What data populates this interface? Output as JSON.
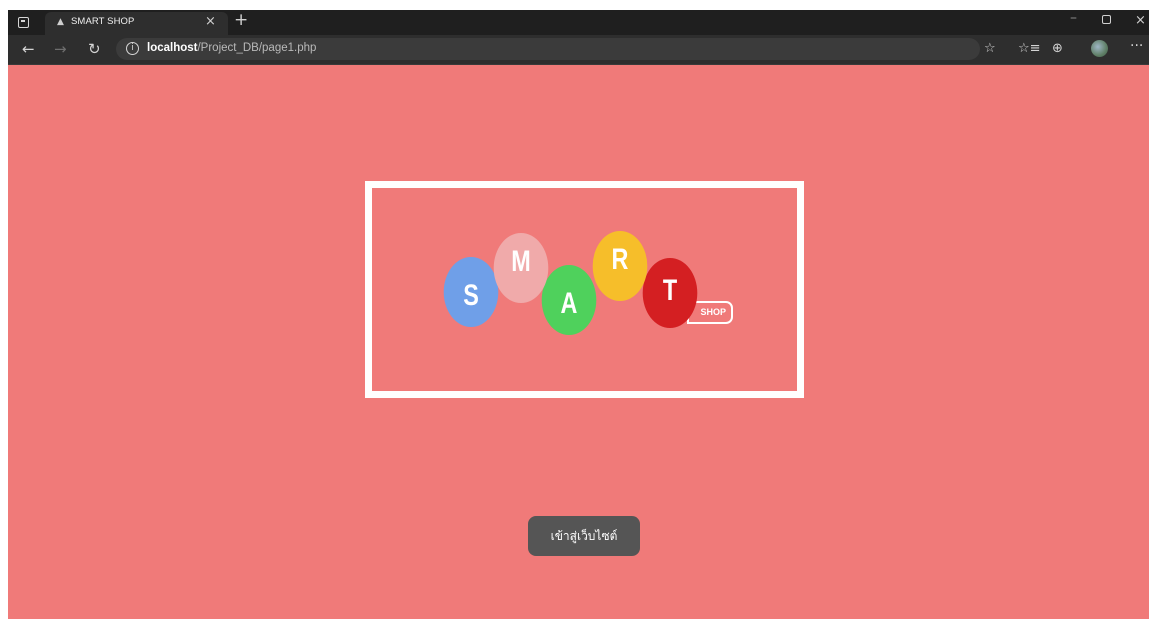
{
  "browser": {
    "tab": {
      "title": "SMART SHOP",
      "favicon_icon": "caret-up-icon",
      "close_glyph": "×"
    },
    "new_tab_glyph": "+",
    "window_controls": {
      "minimize": "–",
      "close": "×"
    },
    "nav": {
      "back": "←",
      "forward": "→",
      "refresh": "↻"
    },
    "address": {
      "info_glyph": "i",
      "host": "localhost",
      "path": "/Project_DB/page1.php"
    },
    "toolbar": {
      "favorite_glyph": "☆",
      "favorites_glyph": "☆≡",
      "collections_glyph": "⊕",
      "more_glyph": "···"
    }
  },
  "page": {
    "background": "#f07a79",
    "logo": {
      "letters": [
        {
          "char": "S",
          "color": "#6f9fe8"
        },
        {
          "char": "M",
          "color": "#f0aaaa"
        },
        {
          "char": "A",
          "color": "#4fd15c"
        },
        {
          "char": "R",
          "color": "#f6be2a"
        },
        {
          "char": "T",
          "color": "#d41f22"
        }
      ],
      "tag": "SHOP"
    },
    "enter_button": {
      "label": "เข้าสู่เว็บไซต์",
      "color": "#555555"
    }
  }
}
